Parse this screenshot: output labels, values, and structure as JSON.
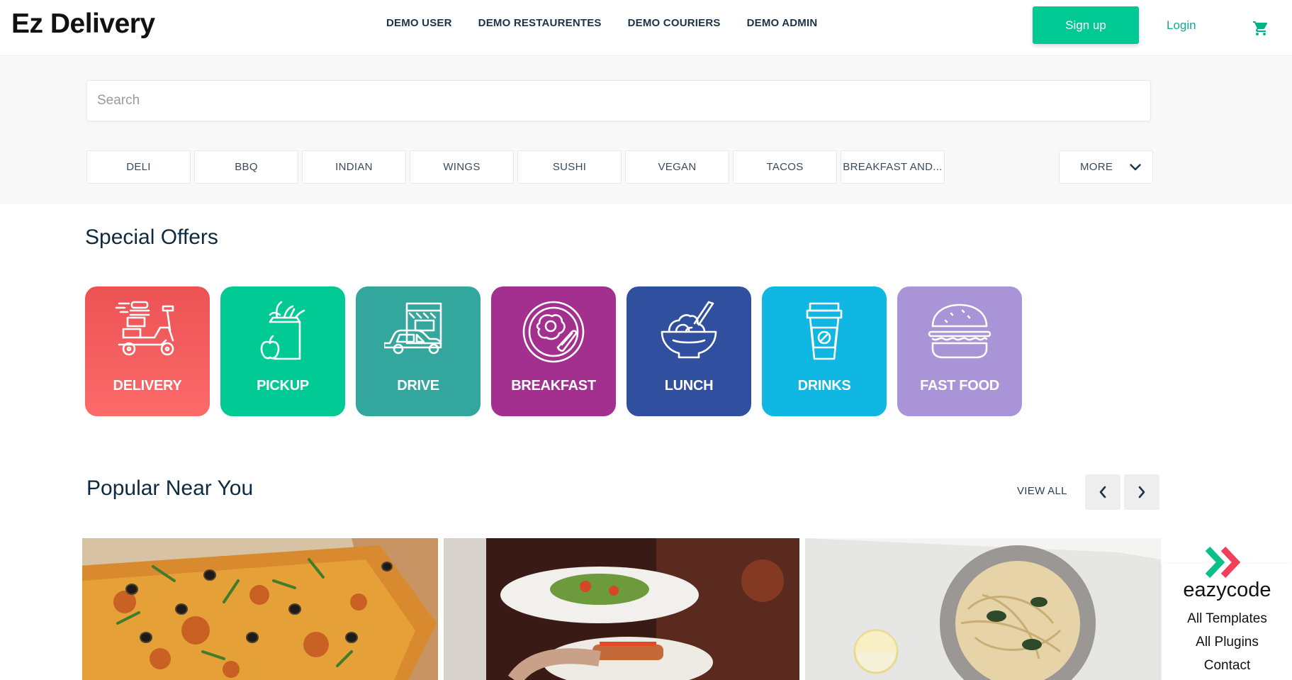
{
  "header": {
    "logo": "Ez Delivery",
    "nav": [
      "DEMO USER",
      "DEMO RESTAURENTES",
      "DEMO COURIERS",
      "DEMO ADMIN"
    ],
    "signup_label": "Sign up",
    "login_label": "Login",
    "cart_icon": "cart-icon"
  },
  "search": {
    "placeholder": "Search"
  },
  "categories": [
    "DELI",
    "BBQ",
    "INDIAN",
    "WINGS",
    "SUSHI",
    "VEGAN",
    "TACOS",
    "BREAKFAST AND..."
  ],
  "more_label": "MORE",
  "special_offers": {
    "title": "Special Offers",
    "items": [
      {
        "label": "DELIVERY",
        "icon": "scooter-icon",
        "color": "#f26060"
      },
      {
        "label": "PICKUP",
        "icon": "grocery-bag-icon",
        "color": "#00c994"
      },
      {
        "label": "DRIVE",
        "icon": "drive-thru-car-icon",
        "color": "#33a69d"
      },
      {
        "label": "BREAKFAST",
        "icon": "egg-bacon-plate-icon",
        "color": "#a3308f"
      },
      {
        "label": "LUNCH",
        "icon": "noodle-bowl-icon",
        "color": "#30509f"
      },
      {
        "label": "DRINKS",
        "icon": "coffee-cup-icon",
        "color": "#10b7e3"
      },
      {
        "label": "FAST FOOD",
        "icon": "burger-icon",
        "color": "#a894d6"
      }
    ]
  },
  "popular": {
    "title": "Popular Near You",
    "view_all": "VIEW ALL",
    "cards": [
      {
        "image": "pizza-image"
      },
      {
        "image": "restaurant-dishes-image"
      },
      {
        "image": "pasta-bowl-image"
      }
    ]
  },
  "widget": {
    "brand": "eazycode",
    "links": [
      "All Templates",
      "All Plugins",
      "Contact"
    ]
  }
}
